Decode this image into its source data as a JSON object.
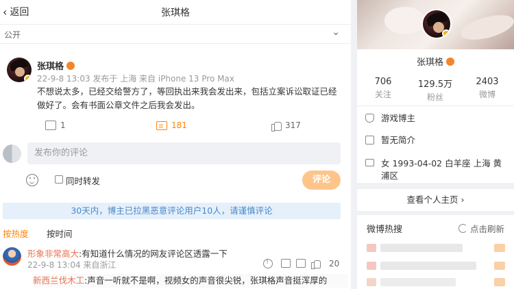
{
  "header": {
    "back_label": "返回",
    "title": "张琪格"
  },
  "visibility": {
    "label": "公开"
  },
  "post": {
    "author": "张琪格",
    "meta": "22-9-8 13:03 发布于 上海 来自 iPhone 13 Pro Max",
    "content": "不想说太多，已经交给警方了，等回执出来我会发出来，包括立案诉讼取证已经做好了。会有书面公章文件之后我会发出。",
    "forwards": "1",
    "comments": "181",
    "likes": "317"
  },
  "composer": {
    "placeholder": "发布你的评论",
    "repost_label": "同时转发",
    "submit_label": "评论"
  },
  "notice": "30天内，博主已拉黑恶意评论用户10人，请谨慎评论",
  "sort": {
    "hot": "按热度",
    "time": "按时间"
  },
  "top_comment": {
    "name": "形象非常高大",
    "text": ":有知道什么情况的网友评论区透露一下",
    "meta": "22-9-8 13:04 来自浙江",
    "likes": "20",
    "reply_name": "新西兰伐木工",
    "reply_text": ":声音一听就不是啊，视频女的声音很尖锐，张琪格声音挺浑厚的"
  },
  "profile": {
    "name": "张琪格",
    "stats": [
      {
        "num": "706",
        "label": "关注"
      },
      {
        "num": "129.5万",
        "label": "粉丝"
      },
      {
        "num": "2403",
        "label": "微博"
      }
    ],
    "tag": "游戏博主",
    "bio": "暂无简介",
    "info": "女    1993-04-02 白羊座    上海 黄浦区",
    "home_link": "查看个人主页 ›"
  },
  "hot": {
    "title": "微博热搜",
    "refresh": "点击刷新"
  },
  "colors": {
    "accent": "#ff8200",
    "link": "#eb7350",
    "notice_bg": "#e5f0fb",
    "notice_text": "#4a87c8"
  }
}
